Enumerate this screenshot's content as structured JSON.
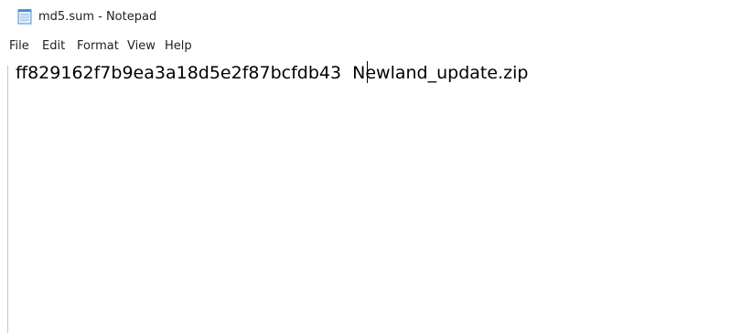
{
  "window": {
    "title": "md5.sum - Notepad",
    "icon": "notepad-icon"
  },
  "menu": {
    "file": "File",
    "edit": "Edit",
    "format": "Format",
    "view": "View",
    "help": "Help"
  },
  "editor": {
    "content": "ff829162f7b9ea3a18d5e2f87bcfdb43  Newland_update.zip"
  },
  "colors": {
    "icon_blue": "#4f8fd6",
    "icon_light": "#dfeefc"
  }
}
